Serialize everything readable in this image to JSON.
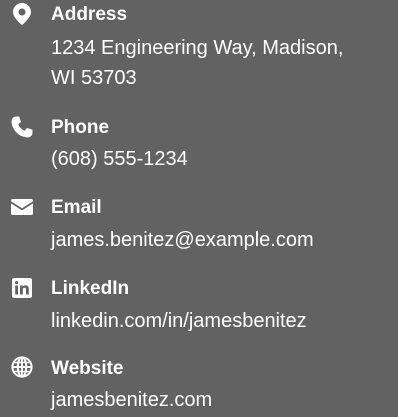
{
  "contact": {
    "address": {
      "label": "Address",
      "line1": "1234 Engineering Way, Madison,",
      "line2": "WI 53703",
      "icon": "map-marker-icon"
    },
    "phone": {
      "label": "Phone",
      "value": "(608) 555-1234",
      "icon": "phone-icon"
    },
    "email": {
      "label": "Email",
      "value": "james.benitez@example.com",
      "icon": "envelope-icon"
    },
    "linkedin": {
      "label": "LinkedIn",
      "value": "linkedin.com/in/jamesbenitez",
      "icon": "linkedin-icon"
    },
    "website": {
      "label": "Website",
      "value": "jamesbenitez.com",
      "icon": "globe-icon"
    }
  },
  "colors": {
    "background": "#626262",
    "text": "#ffffff"
  }
}
